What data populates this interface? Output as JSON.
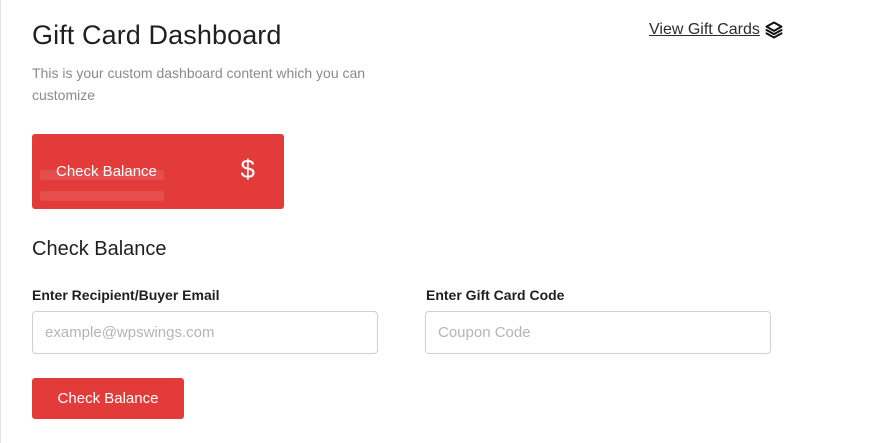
{
  "header": {
    "title": "Gift Card Dashboard",
    "subtitle": "This is your custom dashboard content which you can customize",
    "view_link_label": "View Gift Cards",
    "view_link_icon": "layers-icon"
  },
  "balance_card": {
    "label": "Check Balance",
    "icon_glyph": "$",
    "icon": "dollar-icon",
    "color": "#e33a3a"
  },
  "form": {
    "section_title": "Check Balance",
    "email_label": "Enter Recipient/Buyer Email",
    "email_placeholder": "example@wpswings.com",
    "email_value": "",
    "code_label": "Enter Gift Card Code",
    "code_placeholder": "Coupon Code",
    "code_value": "",
    "submit_label": "Check Balance"
  },
  "colors": {
    "accent": "#e33a3a",
    "text": "#1f1f1f",
    "muted": "#8a8a8a"
  }
}
